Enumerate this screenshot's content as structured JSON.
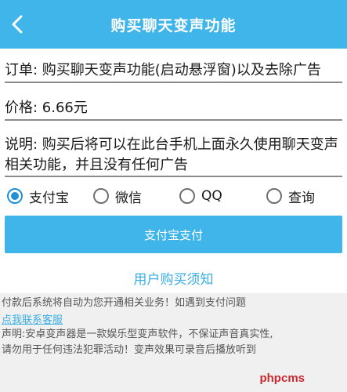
{
  "header": {
    "title": "购买聊天变声功能",
    "back_icon": "chevron-left-icon"
  },
  "form": {
    "order": "订单: 购买聊天变声功能(启动悬浮窗)以及去除广告",
    "price": "价格: 6.66元",
    "note": "说明: 购买后将可以在此台手机上面永久使用聊天变声相关功能，并且没有任何广告"
  },
  "payment_methods": {
    "selected": "支付宝",
    "options": [
      "支付宝",
      "微信",
      "QQ",
      "查询"
    ]
  },
  "pay_button": "支付宝支付",
  "notice_link": "用户购买须知",
  "info": {
    "line1": "付款后系统将自动为您开通相关业务！如遇到支付问题",
    "contact_link": "点我联系客服",
    "line3": "声明:安卓变声器是一款娱乐型变声软件，不保证声音真实性,",
    "line4": "请勿用于任何违法犯罪活动！变声效果可录音后播放听到"
  },
  "watermark": "phpcms",
  "colors": {
    "primary": "#3fb5ea",
    "link": "#3aaee5",
    "radio_checked": "#1f8fd6",
    "watermark": "#c8282d"
  }
}
